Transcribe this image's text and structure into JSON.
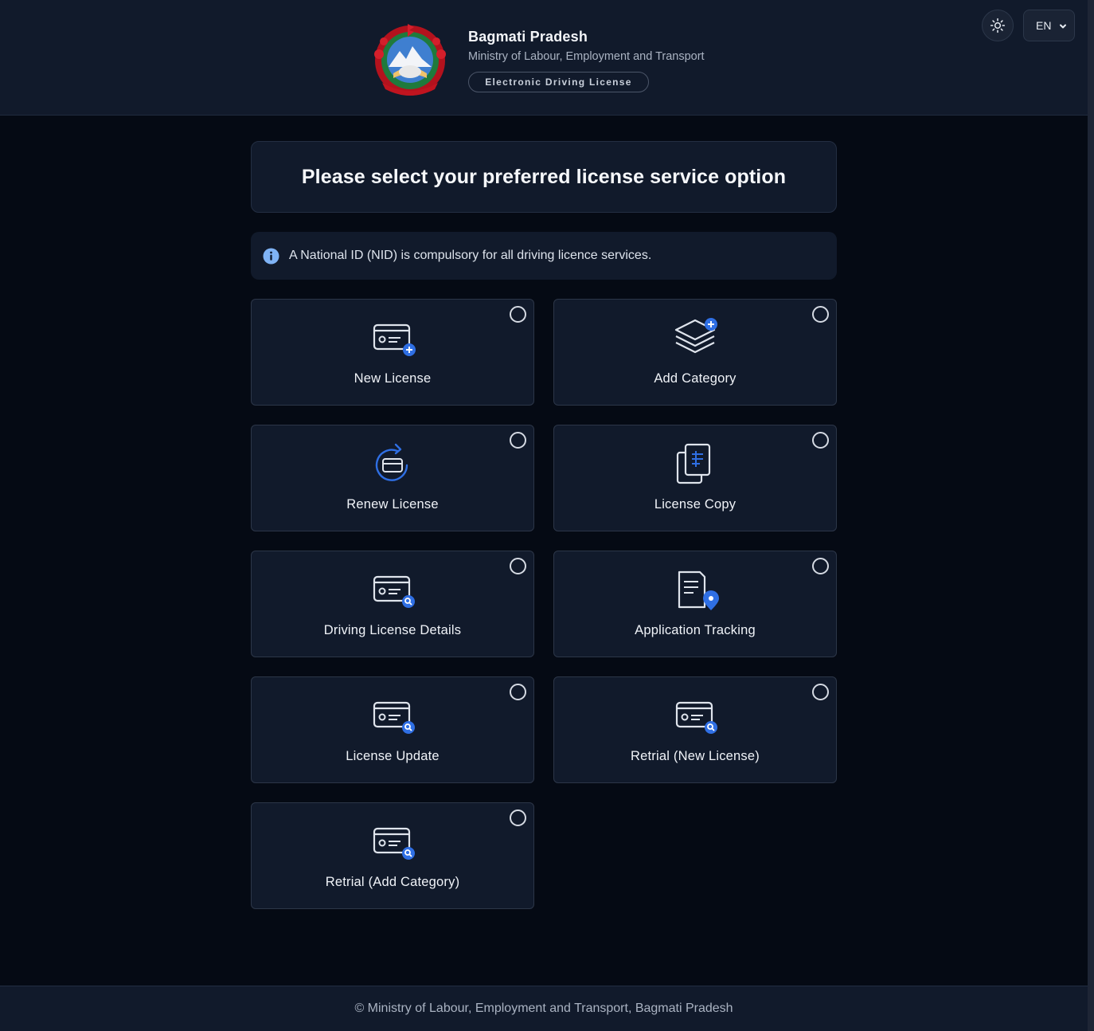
{
  "header": {
    "title": "Bagmati Pradesh",
    "subtitle": "Ministry of Labour, Employment and Transport",
    "badge": "Electronic Driving License",
    "emblem_icon": "nepal-emblem",
    "theme_icon": "sun-icon",
    "language": "EN"
  },
  "main": {
    "heading": "Please select your preferred license service option",
    "notice": "A National ID (NID) is compulsory for all driving licence services.",
    "options": [
      {
        "label": "New License",
        "icon": "license-card-add-icon",
        "selected": false
      },
      {
        "label": "Add Category",
        "icon": "layers-add-icon",
        "selected": false
      },
      {
        "label": "Renew License",
        "icon": "renew-card-icon",
        "selected": false
      },
      {
        "label": "License Copy",
        "icon": "copy-document-icon",
        "selected": false
      },
      {
        "label": "Driving License Details",
        "icon": "license-card-search-icon",
        "selected": false
      },
      {
        "label": "Application Tracking",
        "icon": "document-location-icon",
        "selected": false
      },
      {
        "label": "License Update",
        "icon": "license-card-search-icon",
        "selected": false
      },
      {
        "label": "Retrial (New License)",
        "icon": "license-card-search-icon",
        "selected": false
      },
      {
        "label": "Retrial (Add Category)",
        "icon": "license-card-search-icon",
        "selected": false
      }
    ]
  },
  "footer": {
    "text": "© Ministry of Labour, Employment and Transport, Bagmati Pradesh"
  },
  "colors": {
    "page_bg": "#050a14",
    "card_bg": "#111a2b",
    "accent_blue": "#2f6fe4",
    "info_blue": "#7fb3f5"
  }
}
